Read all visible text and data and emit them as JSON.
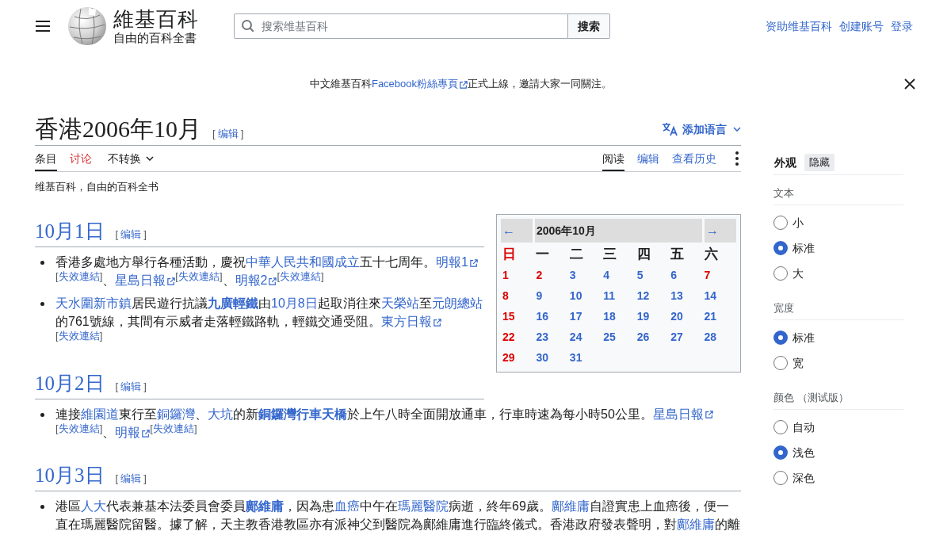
{
  "header": {
    "wordmark": "維基百科",
    "tagline": "自由的百科全書",
    "search": {
      "placeholder": "搜索维基百科",
      "button": "搜索"
    },
    "user_links": [
      "资助维基百科",
      "创建账号",
      "登录"
    ]
  },
  "site_notice": {
    "segments": [
      {
        "kind": "text",
        "text": "中文維基百科"
      },
      {
        "kind": "ext",
        "text": "Facebook粉絲專頁"
      },
      {
        "kind": "text",
        "text": "正式上線，邀請大家一同關注。"
      }
    ]
  },
  "page": {
    "title": "香港2006年10月",
    "edit": {
      "open": "[",
      "label": "编辑",
      "close": "]"
    },
    "language_button": "添加语言",
    "namespace_tabs": [
      {
        "label": "条目",
        "selected": true,
        "missing": false
      },
      {
        "label": "讨论",
        "selected": false,
        "missing": true
      }
    ],
    "variant_menu": "不转换",
    "view_tabs": [
      {
        "label": "阅读",
        "selected": true
      },
      {
        "label": "编辑",
        "selected": false
      },
      {
        "label": "查看历史",
        "selected": false
      }
    ],
    "tagline": "维基百科，自由的百科全书"
  },
  "calendar": {
    "prev": "←",
    "title": "2006年10月",
    "next": "→",
    "weekdays": [
      {
        "label": "日",
        "color": "#dd0000"
      },
      {
        "label": "一",
        "color": "#202122"
      },
      {
        "label": "二",
        "color": "#202122"
      },
      {
        "label": "三",
        "color": "#202122"
      },
      {
        "label": "四",
        "color": "#202122"
      },
      {
        "label": "五",
        "color": "#202122"
      },
      {
        "label": "六",
        "color": "#202122"
      }
    ],
    "days": [
      {
        "label": "1",
        "color": "#dd0000"
      },
      {
        "label": "2",
        "color": "#dd0000"
      },
      {
        "label": "3",
        "color": "#3366cc"
      },
      {
        "label": "4",
        "color": "#3366cc"
      },
      {
        "label": "5",
        "color": "#3366cc"
      },
      {
        "label": "6",
        "color": "#3366cc"
      },
      {
        "label": "7",
        "color": "#dd0000"
      },
      {
        "label": "8",
        "color": "#dd0000"
      },
      {
        "label": "9",
        "color": "#3366cc"
      },
      {
        "label": "10",
        "color": "#3366cc"
      },
      {
        "label": "11",
        "color": "#3366cc"
      },
      {
        "label": "12",
        "color": "#3366cc"
      },
      {
        "label": "13",
        "color": "#3366cc"
      },
      {
        "label": "14",
        "color": "#3366cc"
      },
      {
        "label": "15",
        "color": "#dd0000"
      },
      {
        "label": "16",
        "color": "#3366cc"
      },
      {
        "label": "17",
        "color": "#3366cc"
      },
      {
        "label": "18",
        "color": "#3366cc"
      },
      {
        "label": "19",
        "color": "#3366cc"
      },
      {
        "label": "20",
        "color": "#3366cc"
      },
      {
        "label": "21",
        "color": "#3366cc"
      },
      {
        "label": "22",
        "color": "#dd0000"
      },
      {
        "label": "23",
        "color": "#3366cc"
      },
      {
        "label": "24",
        "color": "#3366cc"
      },
      {
        "label": "25",
        "color": "#3366cc"
      },
      {
        "label": "26",
        "color": "#3366cc"
      },
      {
        "label": "27",
        "color": "#3366cc"
      },
      {
        "label": "28",
        "color": "#3366cc"
      },
      {
        "label": "29",
        "color": "#dd0000"
      },
      {
        "label": "30",
        "color": "#3366cc"
      },
      {
        "label": "31",
        "color": "#3366cc"
      }
    ]
  },
  "sections": [
    {
      "heading": "10月1日",
      "edit": {
        "open": "[",
        "label": "编辑",
        "close": "]"
      },
      "items": [
        {
          "segments": [
            {
              "kind": "text",
              "text": "香港多處地方舉行各種活動，慶祝"
            },
            {
              "kind": "link",
              "text": "中華人民共和國成立"
            },
            {
              "kind": "text",
              "text": "五十七周年。"
            },
            {
              "kind": "ext",
              "text": "明報1"
            },
            {
              "kind": "note",
              "open": "[",
              "text": "失效連結",
              "close": "]"
            },
            {
              "kind": "text",
              "text": "、"
            },
            {
              "kind": "ext",
              "text": "星島日報"
            },
            {
              "kind": "note",
              "open": "[",
              "text": "失效連結",
              "close": "]"
            },
            {
              "kind": "text",
              "text": "、"
            },
            {
              "kind": "ext",
              "text": "明報2"
            },
            {
              "kind": "note",
              "open": "[",
              "text": "失效連結",
              "close": "]"
            }
          ]
        },
        {
          "segments": [
            {
              "kind": "link",
              "text": "天水圍新市鎮"
            },
            {
              "kind": "text",
              "text": "居民遊行抗議"
            },
            {
              "kind": "link",
              "text": "九廣輕鐵",
              "bold": true
            },
            {
              "kind": "text",
              "text": "由"
            },
            {
              "kind": "link",
              "text": "10月8日"
            },
            {
              "kind": "text",
              "text": "起取消往來"
            },
            {
              "kind": "link",
              "text": "天榮站"
            },
            {
              "kind": "text",
              "text": "至"
            },
            {
              "kind": "link",
              "text": "元朗總站"
            },
            {
              "kind": "text",
              "text": "的761號線，其間有示威者走落輕鐵路軌，輕鐵交通受阻。"
            },
            {
              "kind": "ext",
              "text": "東方日報"
            },
            {
              "kind": "note",
              "open": "[",
              "text": "失效連結",
              "close": "]"
            }
          ]
        }
      ]
    },
    {
      "heading": "10月2日",
      "edit": {
        "open": "[",
        "label": "编辑",
        "close": "]"
      },
      "items": [
        {
          "segments": [
            {
              "kind": "text",
              "text": "連接"
            },
            {
              "kind": "link",
              "text": "維園道"
            },
            {
              "kind": "text",
              "text": "東行至"
            },
            {
              "kind": "link",
              "text": "銅鑼灣"
            },
            {
              "kind": "text",
              "text": "、"
            },
            {
              "kind": "link",
              "text": "大坑"
            },
            {
              "kind": "text",
              "text": "的新"
            },
            {
              "kind": "link",
              "text": "銅鑼灣行車天橋",
              "bold": true
            },
            {
              "kind": "text",
              "text": "於上午八時全面開放通車，行車時速為每小時50公里。"
            },
            {
              "kind": "ext",
              "text": "星島日報"
            },
            {
              "kind": "note",
              "open": "[",
              "text": "失效連結",
              "close": "]"
            },
            {
              "kind": "text",
              "text": "、"
            },
            {
              "kind": "ext",
              "text": "明報"
            },
            {
              "kind": "note",
              "open": "[",
              "text": "失效連結",
              "close": "]"
            }
          ]
        }
      ]
    },
    {
      "heading": "10月3日",
      "edit": {
        "open": "[",
        "label": "编辑",
        "close": "]"
      },
      "items": [
        {
          "segments": [
            {
              "kind": "text",
              "text": "港區"
            },
            {
              "kind": "link",
              "text": "人大"
            },
            {
              "kind": "text",
              "text": "代表兼基本法委員會委員"
            },
            {
              "kind": "link",
              "text": "鄺維庸",
              "bold": true
            },
            {
              "kind": "text",
              "text": "，因為患"
            },
            {
              "kind": "link",
              "text": "血癌"
            },
            {
              "kind": "text",
              "text": "中午在"
            },
            {
              "kind": "link",
              "text": "瑪麗醫院"
            },
            {
              "kind": "text",
              "text": "病逝，終年69歲。"
            },
            {
              "kind": "link",
              "text": "鄺維庸"
            },
            {
              "kind": "text",
              "text": "自證實患上血癌後，便一直在瑪麗醫院留醫。據了解，天主教香港教區亦有派神父到醫院為鄺維庸進行臨終儀式。香港政府發表聲明，對"
            },
            {
              "kind": "link",
              "text": "鄺維庸"
            },
            {
              "kind": "text",
              "text": "的離"
            }
          ]
        }
      ]
    }
  ],
  "sidebar": {
    "title": "外观",
    "hide_button": "隐藏",
    "groups": [
      {
        "heading": "文本",
        "options": [
          {
            "label": "小",
            "selected": false
          },
          {
            "label": "标准",
            "selected": true
          },
          {
            "label": "大",
            "selected": false
          }
        ]
      },
      {
        "heading": "宽度",
        "options": [
          {
            "label": "标准",
            "selected": true
          },
          {
            "label": "宽",
            "selected": false
          }
        ]
      },
      {
        "heading": "颜色 （测试版）",
        "options": [
          {
            "label": "自动",
            "selected": false
          },
          {
            "label": "浅色",
            "selected": true
          },
          {
            "label": "深色",
            "selected": false
          }
        ]
      }
    ]
  }
}
